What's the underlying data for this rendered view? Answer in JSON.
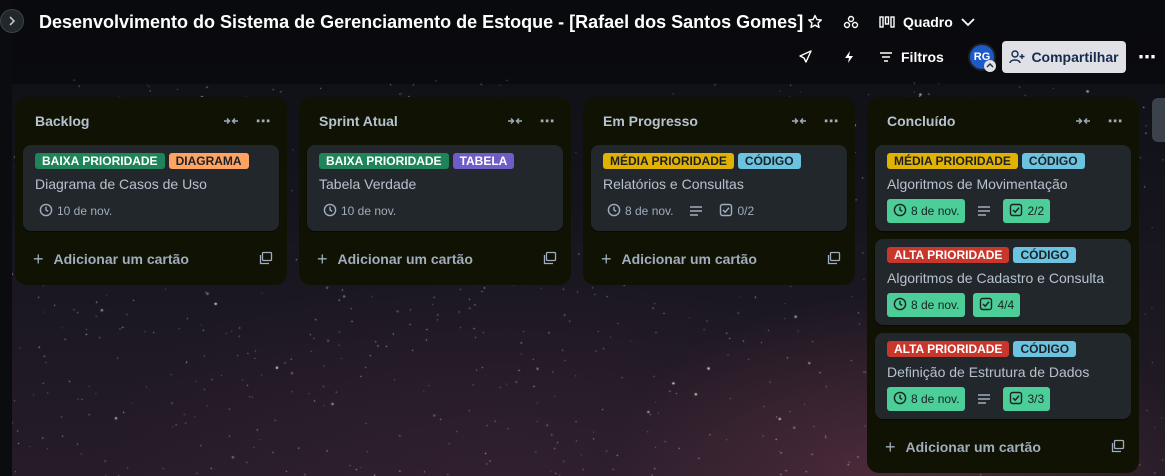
{
  "board": {
    "title": "Desenvolvimento do Sistema de Gerenciamento de Estoque - [Rafael dos Santos Gomes]",
    "view": "Quadro",
    "filters_label": "Filtros",
    "avatar_initials": "RG",
    "share_label": "Compartilhar"
  },
  "icons": {
    "star": "star-icon",
    "visibility": "workspace-visibility-icon",
    "board_view": "board-view-icon",
    "chevron": "chevron-down-icon",
    "power_ups": "rocket-icon",
    "automation": "lightning-icon",
    "filter": "filter-icon",
    "more": "more-icon",
    "collapse": "collapse-list-icon",
    "clock": "clock-icon",
    "description": "description-icon",
    "checklist": "checklist-icon",
    "template": "card-template-icon"
  },
  "colors": {
    "baixa": "#1f845a",
    "media": "#e2b203",
    "alta": "#c9372c",
    "diagrama": "#fea362",
    "tabela": "#6e5dc6",
    "codigo": "#6cc3e0",
    "done_badge": "#4bce97"
  },
  "lists": [
    {
      "title": "Backlog",
      "add_card_label": "Adicionar um cartão",
      "cards": [
        {
          "labels": [
            {
              "text": "BAIXA PRIORIDADE",
              "color": "#1f845a",
              "fg": "#ffffff"
            },
            {
              "text": "DIAGRAMA",
              "color": "#fea362",
              "fg": "#1d2125"
            }
          ],
          "title": "Diagrama de Casos de Uso",
          "due": "10 de nov."
        }
      ]
    },
    {
      "title": "Sprint Atual",
      "add_card_label": "Adicionar um cartão",
      "cards": [
        {
          "labels": [
            {
              "text": "BAIXA PRIORIDADE",
              "color": "#1f845a",
              "fg": "#ffffff"
            },
            {
              "text": "TABELA",
              "color": "#6e5dc6",
              "fg": "#ffffff"
            }
          ],
          "title": "Tabela Verdade",
          "due": "10 de nov."
        }
      ]
    },
    {
      "title": "Em Progresso",
      "add_card_label": "Adicionar um cartão",
      "cards": [
        {
          "labels": [
            {
              "text": "MÉDIA PRIORIDADE",
              "color": "#e2b203",
              "fg": "#1d2125"
            },
            {
              "text": "CÓDIGO",
              "color": "#6cc3e0",
              "fg": "#1d2125"
            }
          ],
          "title": "Relatórios e Consultas",
          "due": "8 de nov.",
          "has_description": true,
          "checklist": "0/2",
          "complete": false
        }
      ]
    },
    {
      "title": "Concluído",
      "add_card_label": "Adicionar um cartão",
      "cards": [
        {
          "labels": [
            {
              "text": "MÉDIA PRIORIDADE",
              "color": "#e2b203",
              "fg": "#1d2125"
            },
            {
              "text": "CÓDIGO",
              "color": "#6cc3e0",
              "fg": "#1d2125"
            }
          ],
          "title": "Algoritmos de Movimentação",
          "due": "8 de nov.",
          "has_description": true,
          "checklist": "2/2",
          "complete": true
        },
        {
          "labels": [
            {
              "text": "ALTA PRIORIDADE",
              "color": "#c9372c",
              "fg": "#ffffff"
            },
            {
              "text": "CÓDIGO",
              "color": "#6cc3e0",
              "fg": "#1d2125"
            }
          ],
          "title": "Algoritmos de Cadastro e Consulta",
          "due": "8 de nov.",
          "has_description": false,
          "checklist": "4/4",
          "complete": true
        },
        {
          "labels": [
            {
              "text": "ALTA PRIORIDADE",
              "color": "#c9372c",
              "fg": "#ffffff"
            },
            {
              "text": "CÓDIGO",
              "color": "#6cc3e0",
              "fg": "#1d2125"
            }
          ],
          "title": "Definição de Estrutura de Dados",
          "due": "8 de nov.",
          "has_description": true,
          "checklist": "3/3",
          "complete": true
        }
      ]
    }
  ]
}
